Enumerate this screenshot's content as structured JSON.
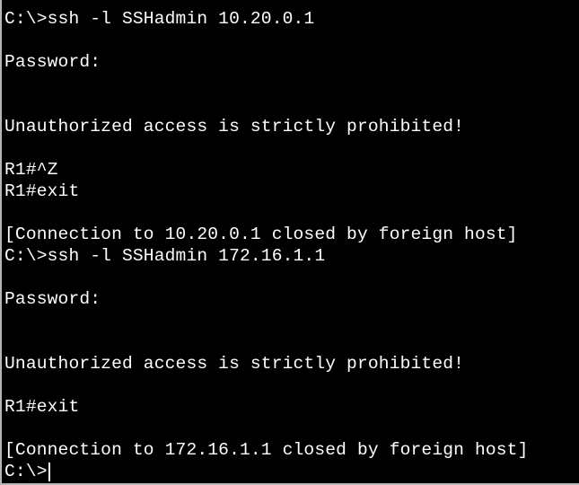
{
  "terminal": {
    "lines": [
      "C:\\>ssh -l SSHadmin 10.20.0.1",
      "",
      "Password:",
      "",
      "",
      "Unauthorized access is strictly prohibited!",
      "",
      "R1#^Z",
      "R1#exit",
      "",
      "[Connection to 10.20.0.1 closed by foreign host]",
      "C:\\>ssh -l SSHadmin 172.16.1.1",
      "",
      "Password:",
      "",
      "",
      "Unauthorized access is strictly prohibited!",
      "",
      "R1#exit",
      "",
      "[Connection to 172.16.1.1 closed by foreign host]"
    ],
    "prompt": "C:\\>"
  }
}
